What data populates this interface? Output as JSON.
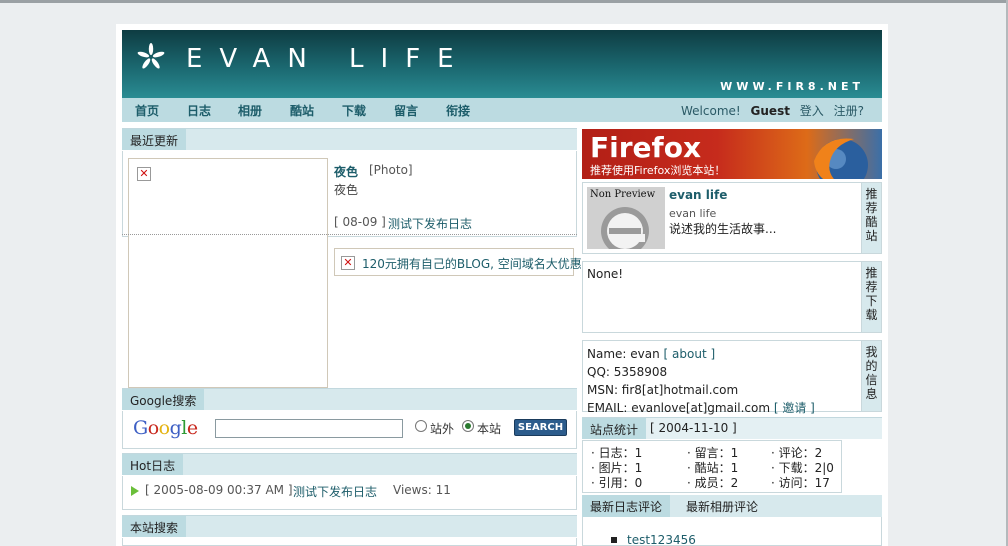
{
  "header": {
    "logo_text": "EVAN LIFE",
    "url_text": "WWW.FIR8.NET"
  },
  "nav": {
    "items": [
      "首页",
      "日志",
      "相册",
      "酷站",
      "下载",
      "留言",
      "衔接"
    ],
    "welcome": "Welcome!",
    "user": "Guest",
    "login": "登入",
    "register": "注册?"
  },
  "recent": {
    "title": "最近更新",
    "post_title": "夜色",
    "post_tag": "[Photo]",
    "post_desc": "夜色",
    "post_date": "[ 08-09 ]",
    "post_link": "测试下发布日志",
    "ad_text": "120元拥有自己的BLOG, 空间域名大优惠"
  },
  "google": {
    "title": "Google搜索",
    "logo": "Google",
    "input_value": "",
    "opt_outside": "站外",
    "opt_site": "本站",
    "button": "SEARCH"
  },
  "hot": {
    "title": "Hot日志",
    "date": "[ 2005-08-09 00:37 AM ]",
    "link": "测试下发布日志",
    "views_label": "Views: 11"
  },
  "site_search": {
    "title": "本站搜索"
  },
  "firefox": {
    "brand": "Firefox",
    "caption": "推荐使用Firefox浏览本站！"
  },
  "cool_site": {
    "preview_label": "Non Preview",
    "name": "evan life",
    "subname": "evan life",
    "desc": "说述我的生活故事...",
    "side": "推荐酷站"
  },
  "download": {
    "text": "None!",
    "side": "推荐下载"
  },
  "myinfo": {
    "name": "Name: evan",
    "about": "[ about ]",
    "qq": "QQ: 5358908",
    "msn": "MSN: fir8[at]hotmail.com",
    "email": "EMAIL: evanlove[at]gmail.com",
    "invite": "[ 邀请 ]",
    "side": "我的信息"
  },
  "stats": {
    "title": "站点统计",
    "date": "[ 2004-11-10 ]",
    "rows": [
      [
        "· 日志：1",
        "· 留言：1",
        "· 评论：2"
      ],
      [
        "· 图片：1",
        "· 酷站：1",
        "· 下载：2|0"
      ],
      [
        "· 引用：0",
        "· 成员：2",
        "· 访问：17"
      ]
    ]
  },
  "comments": {
    "tab_blog": "最新日志评论",
    "tab_album": "最新相册评论",
    "first_item": "test123456"
  },
  "colors": {
    "header_dark": "#0e3c42",
    "header_light": "#2a8c93",
    "nav_bg": "#bcdbe1",
    "section_bg": "#d7e9ed",
    "link": "#1d5d6a"
  }
}
